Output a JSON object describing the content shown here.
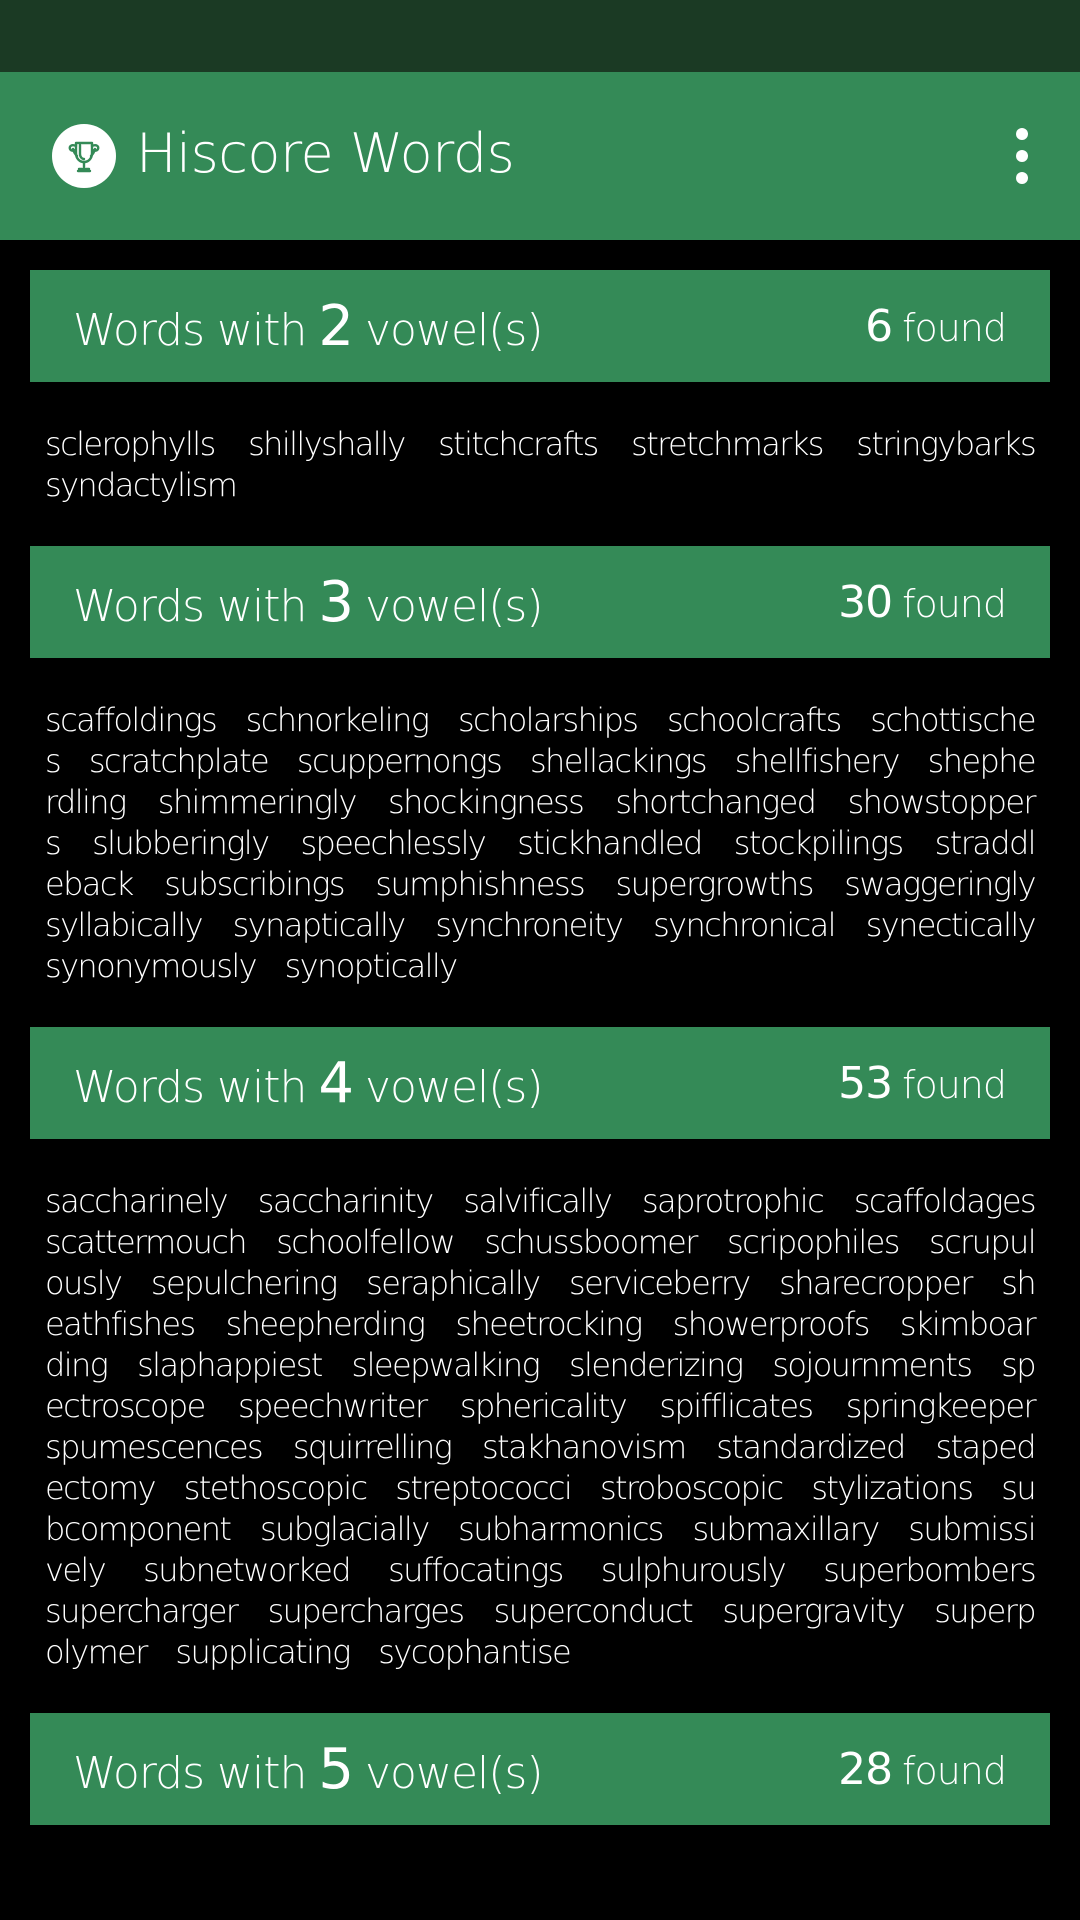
{
  "app": {
    "title": "Hiscore Words",
    "logo_icon": "trophy-icon",
    "menu_icon": "more-vert-icon"
  },
  "colors": {
    "status_bar": "#1b3a24",
    "accent": "#348a57",
    "background": "#000000",
    "text": "#ffffff"
  },
  "sections": [
    {
      "prefix": "Words with",
      "vowels": "2",
      "suffix": "vowel(s)",
      "count": "6",
      "found_label": "found",
      "words": [
        "sclerophylls",
        "shillyshally",
        "stitchcrafts",
        "stretchmarks",
        "stringybarks",
        "syndactylism"
      ]
    },
    {
      "prefix": "Words with",
      "vowels": "3",
      "suffix": "vowel(s)",
      "count": "30",
      "found_label": "found",
      "words": [
        "scaffoldings",
        "schnorkeling",
        "scholarships",
        "schoolcrafts",
        "schottisches",
        "scratchplate",
        "scuppernongs",
        "shellackings",
        "shellfishery",
        "shepherdling",
        "shimmeringly",
        "shockingness",
        "shortchanged",
        "showstoppers",
        "slubberingly",
        "speechlessly",
        "stickhandled",
        "stockpilings",
        "straddleback",
        "subscribings",
        "sumphishness",
        "supergrowths",
        "swaggeringly",
        "syllabically",
        "synaptically",
        "synchroneity",
        "synchronical",
        "synectically",
        "synonymously",
        "synoptically"
      ]
    },
    {
      "prefix": "Words with",
      "vowels": "4",
      "suffix": "vowel(s)",
      "count": "53",
      "found_label": "found",
      "words": [
        "saccharinely",
        "saccharinity",
        "salvifically",
        "saprotrophic",
        "scaffoldages",
        "scattermouch",
        "schoolfellow",
        "schussboomer",
        "scripophiles",
        "scrupulously",
        "sepulchering",
        "seraphically",
        "serviceberry",
        "sharecropper",
        "sheathfishes",
        "sheepherding",
        "sheetrocking",
        "showerproofs",
        "skimboarding",
        "slaphappiest",
        "sleepwalking",
        "slenderizing",
        "sojournments",
        "spectroscope",
        "speechwriter",
        "sphericality",
        "spifflicates",
        "springkeeper",
        "spumescences",
        "squirrelling",
        "stakhanovism",
        "standardized",
        "stapedectomy",
        "stethoscopic",
        "streptococci",
        "stroboscopic",
        "stylizations",
        "subcomponent",
        "subglacially",
        "subharmonics",
        "submaxillary",
        "submissively",
        "subnetworked",
        "suffocatings",
        "sulphurously",
        "superbombers",
        "supercharger",
        "supercharges",
        "superconduct",
        "supergravity",
        "superpolymer",
        "supplicating",
        "sycophantise"
      ]
    },
    {
      "prefix": "Words with",
      "vowels": "5",
      "suffix": "vowel(s)",
      "count": "28",
      "found_label": "found",
      "words": []
    }
  ]
}
